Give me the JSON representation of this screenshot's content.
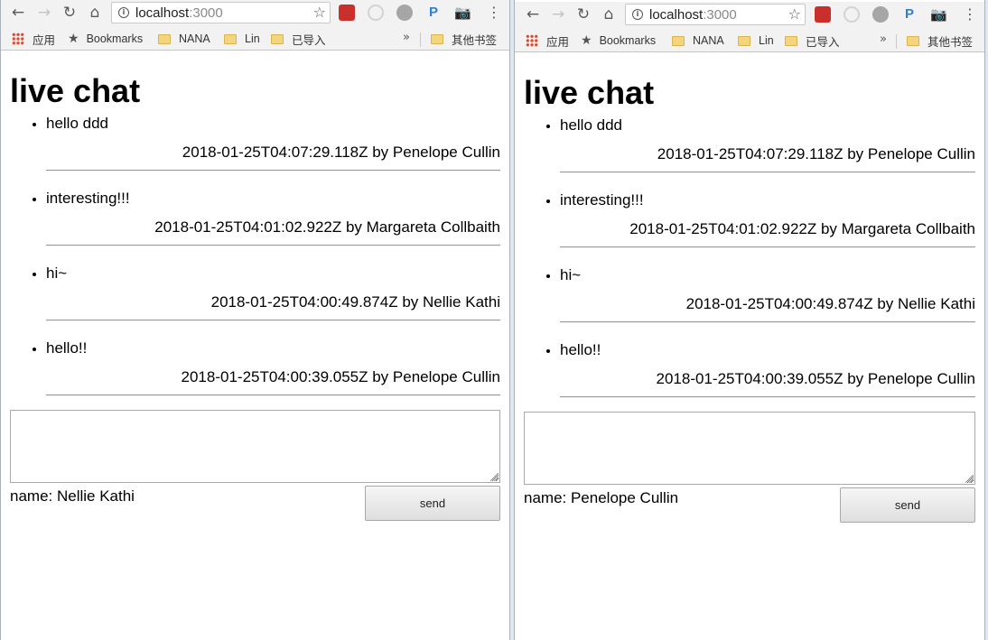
{
  "browser": {
    "url_host": "localhost",
    "url_port": ":3000",
    "bookmarks": [
      {
        "label": "应用",
        "icon": "apps-grid-icon"
      },
      {
        "label": "Bookmarks",
        "icon": "star-icon"
      },
      {
        "label": "NANA",
        "icon": "folder-icon"
      },
      {
        "label": "Lin",
        "icon": "folder-icon"
      },
      {
        "label": "已导入",
        "icon": "folder-icon"
      }
    ],
    "overflow_label": "»",
    "other_bookmarks": "其他书签",
    "toolbar_glyphs": {
      "back": "←",
      "forward": "→",
      "reload": "↻",
      "home": "⌂",
      "star": "☆",
      "menu": "⋮",
      "camera": "📷",
      "p_ext": "P"
    }
  },
  "windows": [
    {
      "title": "live chat",
      "messages": [
        {
          "text": "hello ddd",
          "meta": "2018-01-25T04:07:29.118Z by Penelope Cullin"
        },
        {
          "text": "interesting!!!",
          "meta": "2018-01-25T04:01:02.922Z by Margareta Collbaith"
        },
        {
          "text": "hi~",
          "meta": "2018-01-25T04:00:49.874Z by Nellie Kathi"
        },
        {
          "text": "hello!!",
          "meta": "2018-01-25T04:00:39.055Z by Penelope Cullin"
        }
      ],
      "message_input_value": "",
      "name_line": "name: Nellie Kathi",
      "send_label": "send"
    },
    {
      "title": "live chat",
      "messages": [
        {
          "text": "hello ddd",
          "meta": "2018-01-25T04:07:29.118Z by Penelope Cullin"
        },
        {
          "text": "interesting!!!",
          "meta": "2018-01-25T04:01:02.922Z by Margareta Collbaith"
        },
        {
          "text": "hi~",
          "meta": "2018-01-25T04:00:49.874Z by Nellie Kathi"
        },
        {
          "text": "hello!!",
          "meta": "2018-01-25T04:00:39.055Z by Penelope Cullin"
        }
      ],
      "message_input_value": "",
      "name_line": "name: Penelope Cullin",
      "send_label": "send"
    }
  ],
  "colors": {
    "chrome_bg": "#f2f2f2",
    "ext_red": "#c9302c",
    "ext_p_blue": "#2f7fd4",
    "folder_yellow": "#f4d47c",
    "divider_gray": "#9a9a9a"
  }
}
